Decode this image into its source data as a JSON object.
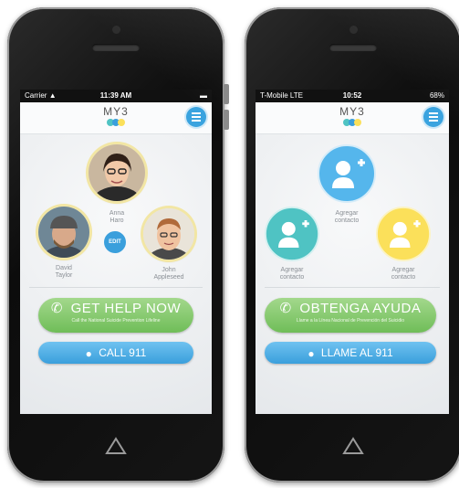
{
  "colors": {
    "blue": "#3a9fdc",
    "green": "#6fbd58",
    "yellow": "#fbe05a",
    "teal": "#4fc3c3",
    "ring": "#f2e6a4"
  },
  "english": {
    "status": {
      "carrier": "Carrier",
      "time": "11:39 AM"
    },
    "logo": "MY3",
    "contacts": [
      {
        "first": "Anna",
        "last": "Haro"
      },
      {
        "first": "David",
        "last": "Taylor"
      },
      {
        "first": "John",
        "last": "Appleseed"
      }
    ],
    "edit_label": "EDIT",
    "help_label": "GET HELP NOW",
    "help_sub": "Call the National Suicide Prevention Lifeline",
    "call_label": "CALL 911"
  },
  "spanish": {
    "status": {
      "carrier": "T-Mobile LTE",
      "time": "10:52",
      "battery": "68%"
    },
    "logo": "MY3",
    "add_contact": {
      "line1": "Agregar",
      "line2": "contacto"
    },
    "help_label": "OBTENGA AYUDA",
    "help_sub": "Llame a la Línea Nacional de Prevención del Suicidio",
    "call_label": "LLAME AL 911"
  }
}
